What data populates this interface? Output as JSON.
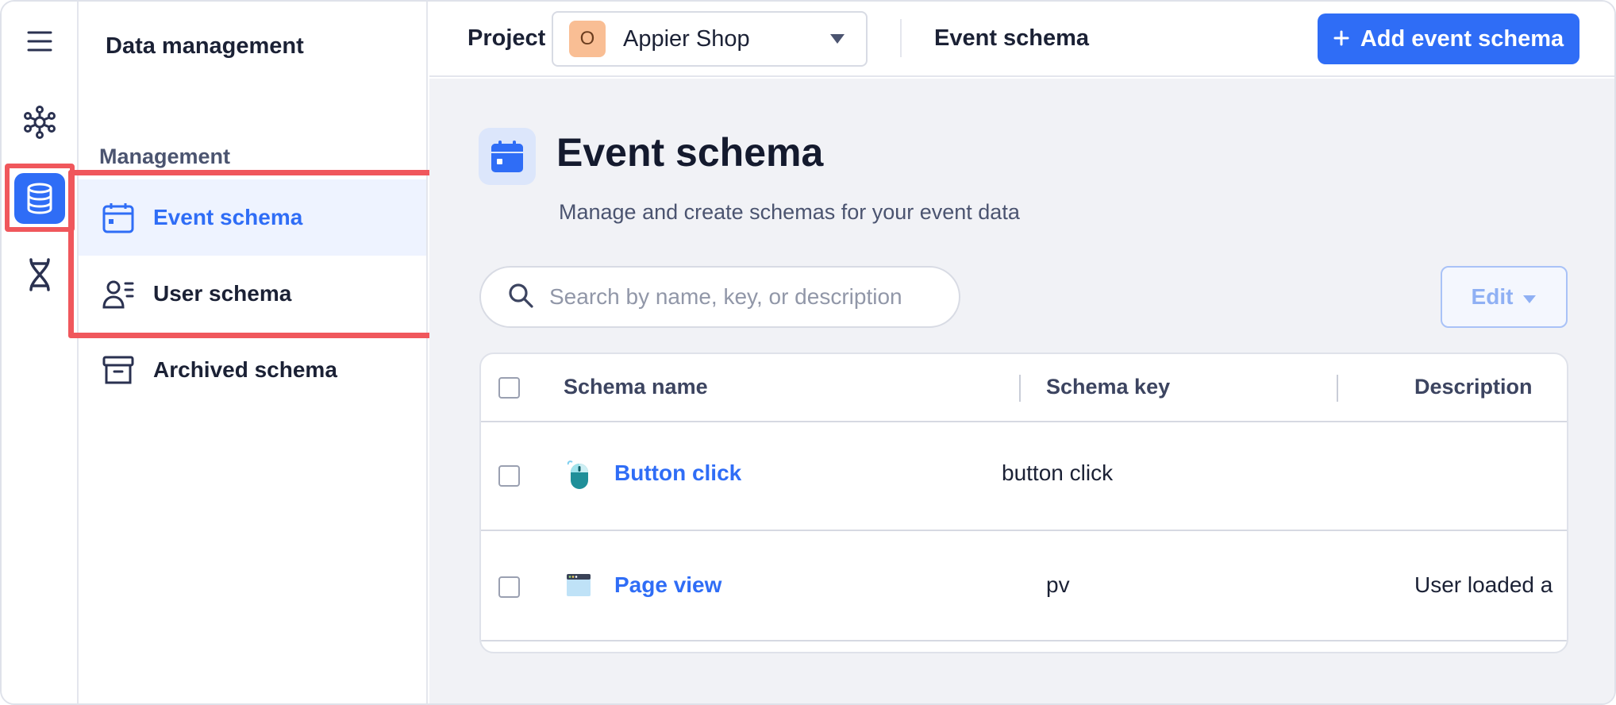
{
  "sidebar": {
    "title": "Data management",
    "section": "Management",
    "items": [
      {
        "label": "Event schema",
        "active": true
      },
      {
        "label": "User schema",
        "active": false
      },
      {
        "label": "Archived schema",
        "active": false
      }
    ]
  },
  "topbar": {
    "project_label": "Project",
    "project_avatar": "O",
    "project_name": "Appier Shop",
    "breadcrumb": "Event schema",
    "add_button": "Add event schema"
  },
  "main": {
    "title": "Event schema",
    "subtitle": "Manage and create schemas for your event data",
    "search_placeholder": "Search by name, key, or description",
    "edit_button": "Edit"
  },
  "table": {
    "columns": [
      "Schema name",
      "Schema key",
      "Description"
    ],
    "rows": [
      {
        "name": "Button click",
        "key": "button click",
        "description": "",
        "icon": "mouse-icon"
      },
      {
        "name": "Page view",
        "key": "pv",
        "description": "User loaded a",
        "icon": "browser-window-icon"
      }
    ]
  },
  "colors": {
    "accent": "#2f6df6",
    "highlight": "#f0575c",
    "main_bg": "#f1f2f6"
  }
}
